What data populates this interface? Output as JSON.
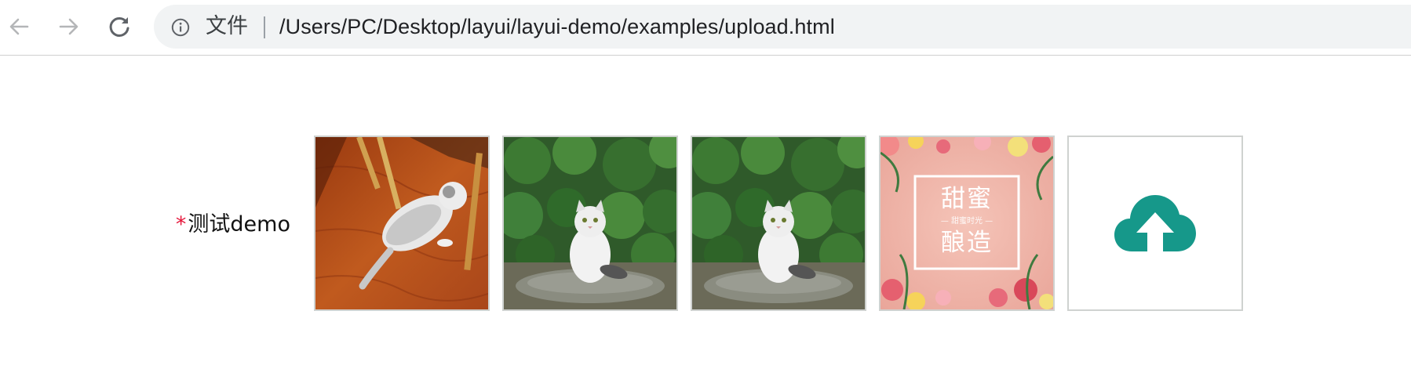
{
  "browser": {
    "back_icon": "arrow-left-icon",
    "forward_icon": "arrow-right-icon",
    "reload_icon": "reload-icon",
    "site_info_icon": "info-icon",
    "site_chip": "文件",
    "url": "/Users/PC/Desktop/layui/layui-demo/examples/upload.html"
  },
  "form": {
    "required_mark": "*",
    "label": "测试demo",
    "colors": {
      "required": "#e6173b",
      "upload_icon": "#16988a",
      "thumb_border": "#cfd2d0"
    },
    "images": [
      {
        "name": "cat-lying-on-wood-floor",
        "caption": ""
      },
      {
        "name": "cat-sitting-before-bush",
        "caption": ""
      },
      {
        "name": "cat-sitting-before-bush",
        "caption": ""
      },
      {
        "name": "pink-floral-poster",
        "caption": "",
        "poster_line1": "甜蜜",
        "poster_sub": "— 甜蜜时光 —",
        "poster_line2": "酿造"
      }
    ],
    "upload_icon": "cloud-upload-icon"
  }
}
